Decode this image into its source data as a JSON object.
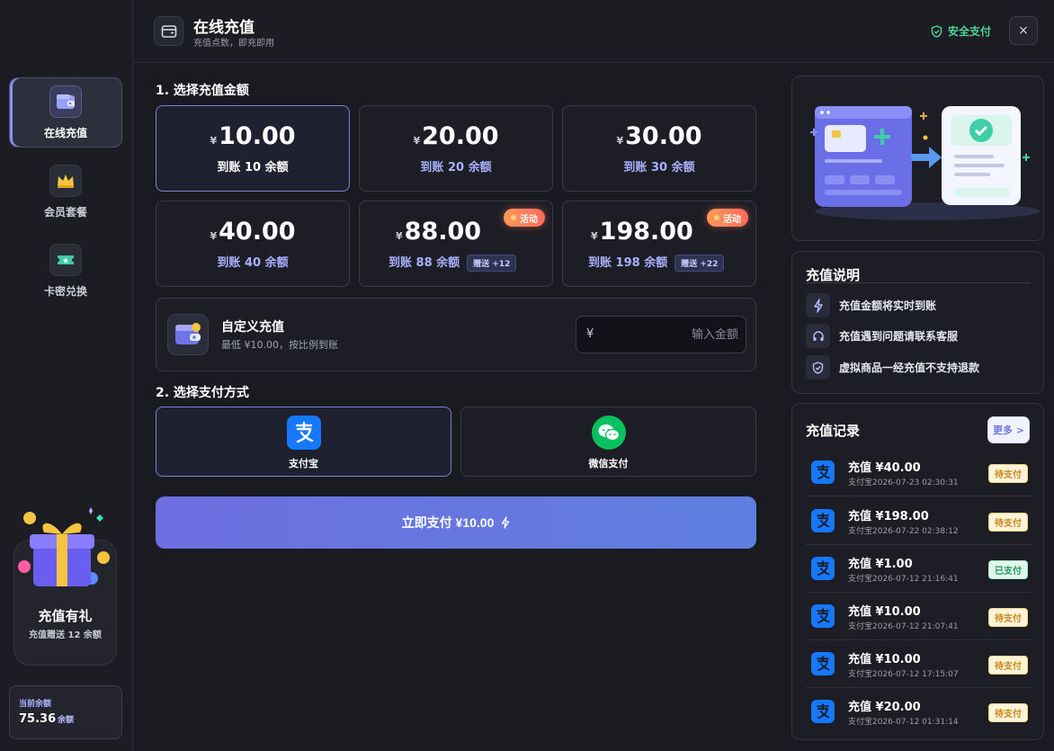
{
  "sidebar": {
    "items": [
      {
        "label": "在线充值",
        "icon": "wallet-icon",
        "active": true
      },
      {
        "label": "会员套餐",
        "icon": "crown-icon",
        "active": false
      },
      {
        "label": "卡密兑换",
        "icon": "ticket-icon",
        "active": false
      }
    ],
    "promo": {
      "title": "充值有礼",
      "subtitle": "充值赠送 12 余额"
    },
    "balance": {
      "label": "当前余额",
      "value": "75.36",
      "unit": "余额"
    }
  },
  "header": {
    "title": "在线充值",
    "subtitle": "充值点数，即充即用",
    "secure_label": "安全支付",
    "close_label": "×"
  },
  "amount_section": {
    "title": "1. 选择充值金额",
    "currency": "¥",
    "options": [
      {
        "price": "10.00",
        "credit": "到账 10 余额",
        "selected": true
      },
      {
        "price": "20.00",
        "credit": "到账 20 余额"
      },
      {
        "price": "30.00",
        "credit": "到账 30 余额"
      },
      {
        "price": "40.00",
        "credit": "到账 40 余额"
      },
      {
        "price": "88.00",
        "credit": "到账 88 余额",
        "bonus": "赠送 +12",
        "badge": "活动"
      },
      {
        "price": "198.00",
        "credit": "到账 198 余额",
        "bonus": "赠送 +22",
        "badge": "活动"
      }
    ],
    "custom": {
      "title": "自定义充值",
      "subtitle": "最低 ¥10.00，按比例到账",
      "currency": "¥",
      "placeholder": "输入金额"
    }
  },
  "payment_section": {
    "title": "2. 选择支付方式",
    "methods": [
      {
        "label": "支付宝",
        "icon": "alipay-icon",
        "selected": true
      },
      {
        "label": "微信支付",
        "icon": "wechat-icon",
        "selected": false
      }
    ],
    "pay_button": "立即支付 ¥10.00"
  },
  "info": {
    "title": "充值说明",
    "items": [
      {
        "text": "充值金额将实时到账",
        "icon": "lightning-icon"
      },
      {
        "text": "充值遇到问题请联系客服",
        "icon": "headset-icon"
      },
      {
        "text": "虚拟商品一经充值不支持退款",
        "icon": "shield-icon"
      }
    ]
  },
  "records": {
    "title": "充值记录",
    "more_label": "更多 >",
    "items": [
      {
        "title": "充值 ¥40.00",
        "sub": "支付宝2026-07-23 02:30:31",
        "status": "待支付",
        "status_type": "pending"
      },
      {
        "title": "充值 ¥198.00",
        "sub": "支付宝2026-07-22 02:38:12",
        "status": "待支付",
        "status_type": "pending"
      },
      {
        "title": "充值 ¥1.00",
        "sub": "支付宝2026-07-12 21:16:41",
        "status": "已支付",
        "status_type": "paid"
      },
      {
        "title": "充值 ¥10.00",
        "sub": "支付宝2026-07-12 21:07:41",
        "status": "待支付",
        "status_type": "pending"
      },
      {
        "title": "充值 ¥10.00",
        "sub": "支付宝2026-07-12 17:15:07",
        "status": "待支付",
        "status_type": "pending"
      },
      {
        "title": "充值 ¥20.00",
        "sub": "支付宝2026-07-12 01:31:14",
        "status": "待支付",
        "status_type": "pending"
      }
    ]
  },
  "colors": {
    "accent": "#7b80d8",
    "pay_button_start": "#6d6fe0",
    "pay_button_end": "#5f7fe0",
    "secure_green": "#4fd39a",
    "alipay_blue": "#1677ff",
    "wechat_green": "#07c160"
  }
}
